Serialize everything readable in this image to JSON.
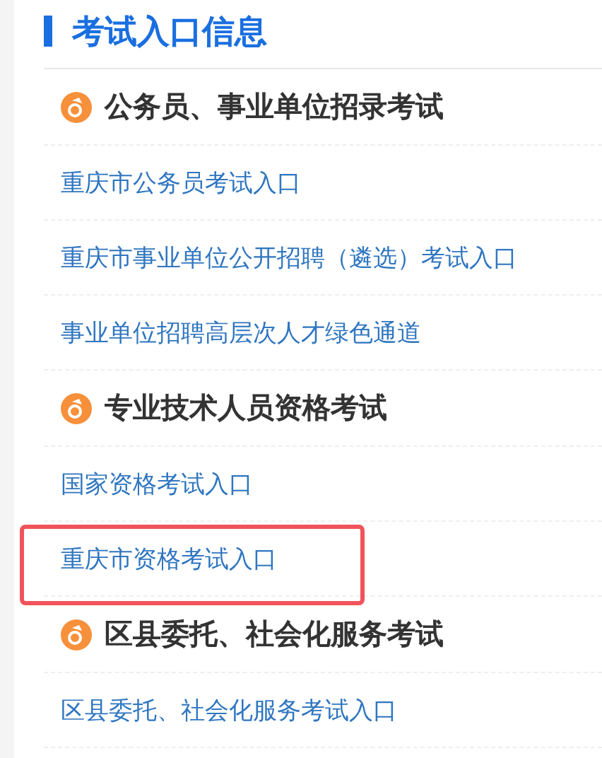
{
  "title": "考试入口信息",
  "sections": [
    {
      "heading": "公务员、事业单位招录考试",
      "links": [
        {
          "label": "重庆市公务员考试入口",
          "highlighted": false
        },
        {
          "label": "重庆市事业单位公开招聘（遴选）考试入口",
          "highlighted": false
        },
        {
          "label": "事业单位招聘高层次人才绿色通道",
          "highlighted": false
        }
      ]
    },
    {
      "heading": "专业技术人员资格考试",
      "links": [
        {
          "label": "国家资格考试入口",
          "highlighted": false
        },
        {
          "label": "重庆市资格考试入口",
          "highlighted": true
        }
      ]
    },
    {
      "heading": "区县委托、社会化服务考试",
      "links": [
        {
          "label": "区县委托、社会化服务考试入口",
          "highlighted": false
        }
      ]
    }
  ]
}
